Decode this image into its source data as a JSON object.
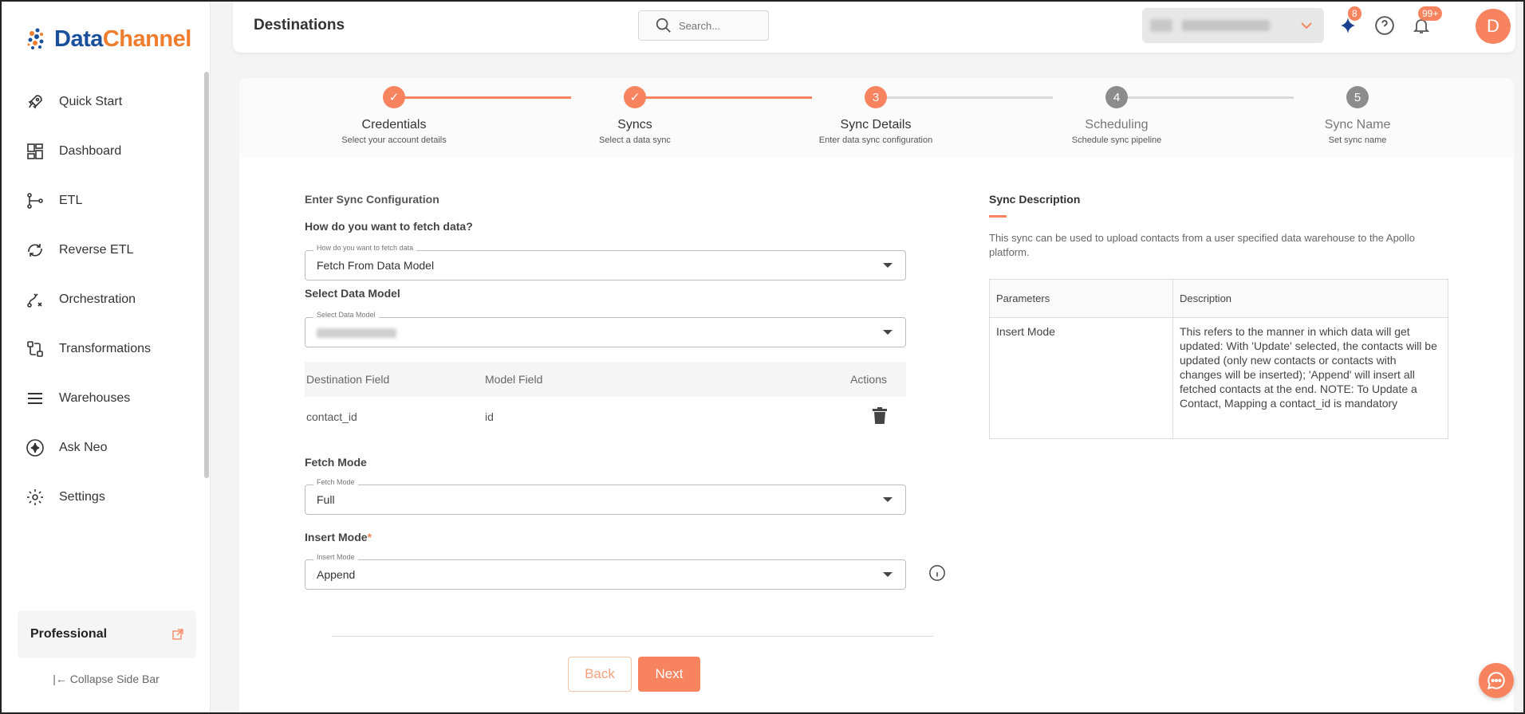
{
  "brand": {
    "logo_part1": "Data",
    "logo_part2": "Channel",
    "accent": "#f7845e"
  },
  "sidebar": {
    "items": [
      {
        "label": "Quick Start",
        "icon": "rocket-icon"
      },
      {
        "label": "Dashboard",
        "icon": "dashboard-icon"
      },
      {
        "label": "ETL",
        "icon": "etl-icon"
      },
      {
        "label": "Reverse ETL",
        "icon": "reverse-etl-icon"
      },
      {
        "label": "Orchestration",
        "icon": "orchestration-icon"
      },
      {
        "label": "Transformations",
        "icon": "transformations-icon"
      },
      {
        "label": "Warehouses",
        "icon": "warehouses-icon"
      },
      {
        "label": "Ask Neo",
        "icon": "sparkle-icon"
      },
      {
        "label": "Settings",
        "icon": "gear-icon"
      }
    ],
    "plan": "Professional",
    "collapse": "Collapse Side Bar"
  },
  "header": {
    "title": "Destinations",
    "search_placeholder": "Search...",
    "sparkle_badge": "8",
    "notifications_badge": "99+",
    "avatar_initial": "D"
  },
  "stepper": {
    "steps": [
      {
        "title": "Credentials",
        "sub": "Select your account details",
        "status": "done"
      },
      {
        "title": "Syncs",
        "sub": "Select a data sync",
        "status": "done"
      },
      {
        "title": "Sync Details",
        "sub": "Enter data sync configuration",
        "status": "active",
        "number": "3"
      },
      {
        "title": "Scheduling",
        "sub": "Schedule sync pipeline",
        "status": "pending",
        "number": "4"
      },
      {
        "title": "Sync Name",
        "sub": "Set sync name",
        "status": "pending",
        "number": "5"
      }
    ]
  },
  "form": {
    "section_title": "Enter Sync Configuration",
    "fetch_question": "How do you want to fetch data?",
    "fetch_legend": "How do you want to fetch data",
    "fetch_value": "Fetch From Data Model",
    "model_title": "Select Data Model",
    "model_legend": "Select Data Model",
    "mapping": {
      "headers": [
        "Destination Field",
        "Model Field",
        "Actions"
      ],
      "rows": [
        {
          "destination": "contact_id",
          "model": "id"
        }
      ]
    },
    "fetch_mode_title": "Fetch Mode",
    "fetch_mode_legend": "Fetch Mode",
    "fetch_mode_value": "Full",
    "insert_mode_title": "Insert Mode",
    "insert_mode_required": "*",
    "insert_mode_legend": "Insert Mode",
    "insert_mode_value": "Append",
    "back_label": "Back",
    "next_label": "Next"
  },
  "description": {
    "title": "Sync Description",
    "text": "This sync can be used to upload contacts from a user specified data warehouse to the Apollo platform.",
    "table_headers": [
      "Parameters",
      "Description"
    ],
    "rows": [
      {
        "parameter": "Insert Mode",
        "description": "This refers to the manner in which data will get updated: With 'Update' selected, the contacts will be updated (only new contacts or contacts with changes will be inserted); 'Append' will insert all fetched contacts at the end. NOTE: To Update a Contact, Mapping a contact_id is mandatory"
      }
    ]
  }
}
